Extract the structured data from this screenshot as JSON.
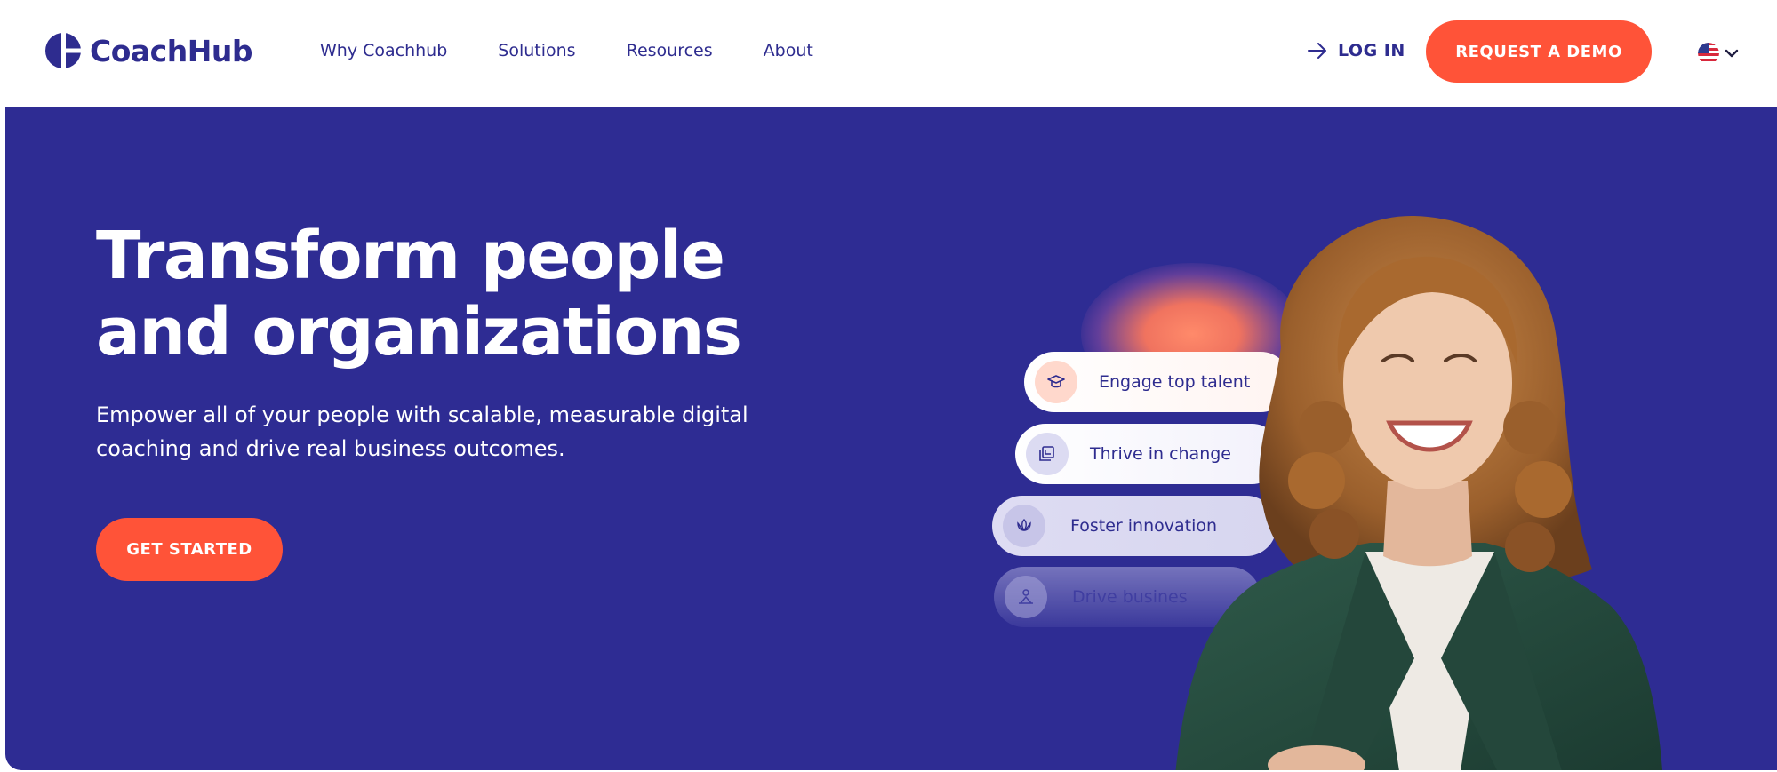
{
  "brand": {
    "name": "CoachHub",
    "accent": "#ff5338",
    "primary": "#2e2c93"
  },
  "nav": {
    "items": [
      {
        "label": "Why Coachhub"
      },
      {
        "label": "Solutions"
      },
      {
        "label": "Resources"
      },
      {
        "label": "About"
      }
    ],
    "login_label": "LOG IN",
    "login_icon": "arrow-right-icon",
    "demo_label": "REQUEST A DEMO",
    "language_icon": "us-flag-icon"
  },
  "hero": {
    "title": "Transform people and organizations",
    "subtitle": "Empower all of your people with scalable, measurable digital coaching and drive real business outcomes.",
    "cta_label": "GET STARTED",
    "pills": [
      {
        "label": "Engage top talent",
        "icon": "graduation-cap-icon"
      },
      {
        "label": "Thrive in change",
        "icon": "layers-icon"
      },
      {
        "label": "Foster innovation",
        "icon": "lotus-icon"
      },
      {
        "label": "Drive busines",
        "icon": "person-network-icon"
      }
    ]
  }
}
